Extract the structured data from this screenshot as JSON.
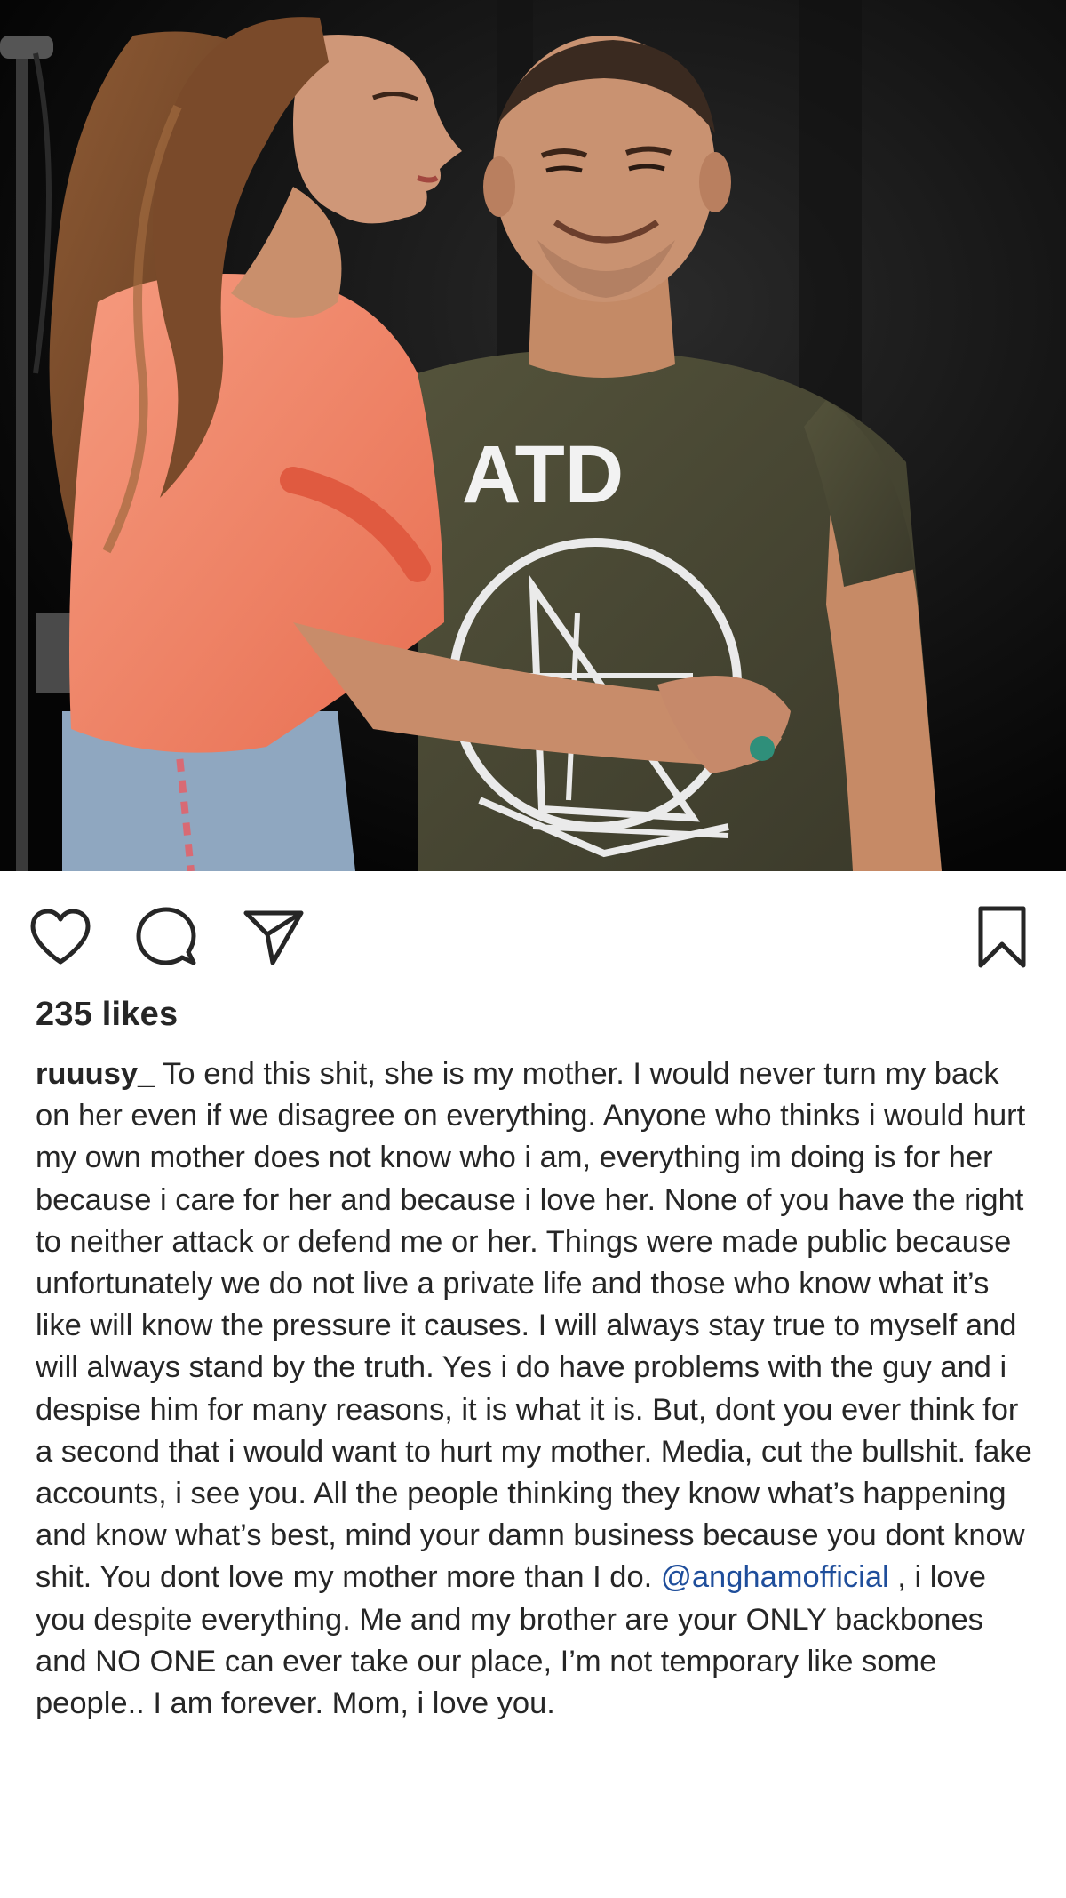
{
  "post": {
    "photo": {
      "shirt_text": "ATD",
      "description_colors": {
        "background": "#0d0d0d",
        "top_salmon": "#f08a6e",
        "shirt_olive": "#4a4a34",
        "hair_brown": "#7a4a2a",
        "skin": "#c98f6c"
      }
    },
    "actions": {
      "like_icon": "heart-icon",
      "comment_icon": "comment-bubble-icon",
      "share_icon": "paper-plane-icon",
      "save_icon": "bookmark-icon"
    },
    "likes": "235 likes",
    "caption": {
      "username": "ruuusy_",
      "text_before_mention": " To end this shit, she is my mother. I would never turn my back on her even if we disagree on everything. Anyone who thinks i would hurt my own mother does not know who i am, everything im doing is for her because i care for her and because i love her. None of you have the right to neither attack or defend me or her. Things were made public because unfortunately we do not live a private life and those who know what it’s like will know the pressure it causes. I will always stay true to myself and will always stand by the truth. Yes i do have problems with the guy and i despise him for many reasons, it is what it is. But, dont you ever think for a second that i would want to hurt my mother. Media, cut the bullshit. fake accounts, i see you. All the people thinking they know what’s happening and know what’s best, mind your damn business because you dont know shit. You dont love my mother more than I do. ",
      "mention": "@anghamofficial",
      "text_after_mention": " , i love you despite everything. Me and my brother are your ONLY backbones and NO ONE can ever take our place, I’m not temporary like some people.. I am forever. Mom, i love you."
    },
    "colors": {
      "text": "#262626",
      "mention": "#1f4e9b",
      "background": "#ffffff"
    }
  }
}
